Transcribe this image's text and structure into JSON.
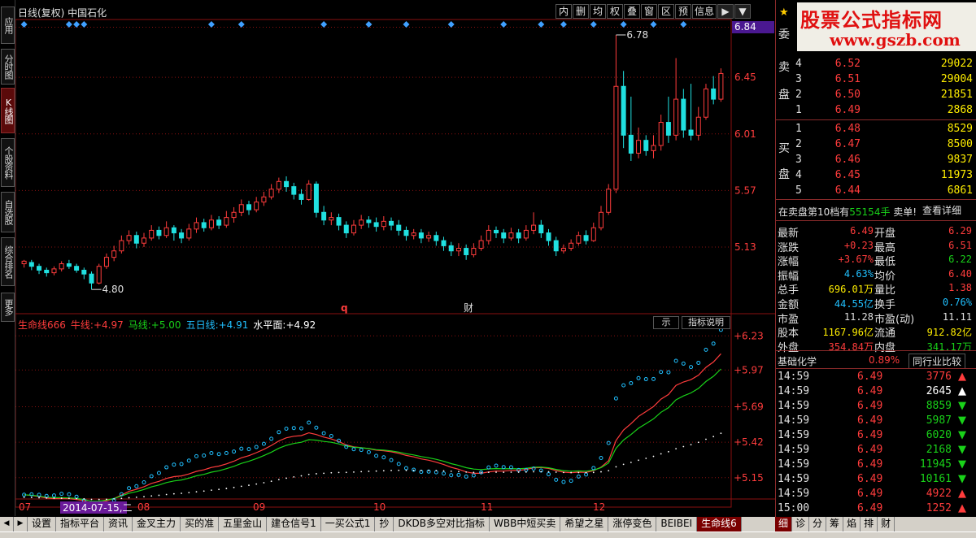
{
  "left_nav": [
    {
      "label": "应用",
      "active": false
    },
    {
      "label": "分时图",
      "active": false
    },
    {
      "label": "K线图",
      "active": true
    },
    {
      "label": "个股资料",
      "active": false
    },
    {
      "label": "自选股",
      "active": false
    },
    {
      "label": "综合排名",
      "active": false
    },
    {
      "label": "更多",
      "active": false
    }
  ],
  "chart": {
    "title": "日线(复权)  中国石化",
    "toolbar": [
      "内",
      "删",
      "均",
      "权",
      "叠",
      "窗",
      "区",
      "预",
      "信息",
      "▶",
      "▼"
    ],
    "price_axis_labels": [
      "6.84",
      "6.45",
      "6.01",
      "5.57",
      "5.13"
    ],
    "price_tag": "6.84",
    "high_marker": "6.78",
    "low_marker": "4.80",
    "event_q": "q",
    "event_cai": "财",
    "month_labels": [
      "07",
      "08",
      "09",
      "10",
      "11",
      "12"
    ],
    "date_tag": "2014-07-15,二"
  },
  "chart_data": [
    {
      "type": "candlestick",
      "title": "日线(复权) 中国石化",
      "ylim": [
        4.7,
        6.9
      ],
      "y_ticks": [
        5.13,
        5.57,
        6.01,
        6.45,
        6.84
      ],
      "x_labels": [
        "07",
        "08",
        "09",
        "10",
        "11",
        "12"
      ],
      "candles": [
        [
          5.0,
          5.02,
          4.97,
          5.03
        ],
        [
          5.01,
          4.98,
          4.95,
          5.03
        ],
        [
          4.98,
          4.95,
          4.92,
          5.0
        ],
        [
          4.95,
          4.93,
          4.9,
          4.97
        ],
        [
          4.93,
          4.96,
          4.91,
          4.98
        ],
        [
          4.96,
          5.0,
          4.94,
          5.02
        ],
        [
          5.0,
          4.98,
          4.96,
          5.03
        ],
        [
          4.98,
          4.95,
          4.93,
          5.0
        ],
        [
          4.95,
          4.92,
          4.88,
          4.97
        ],
        [
          4.92,
          4.85,
          4.8,
          4.94
        ],
        [
          4.85,
          4.98,
          4.84,
          5.0
        ],
        [
          4.98,
          5.05,
          4.96,
          5.08
        ],
        [
          5.05,
          5.1,
          5.02,
          5.14
        ],
        [
          5.1,
          5.18,
          5.08,
          5.22
        ],
        [
          5.18,
          5.22,
          5.15,
          5.26
        ],
        [
          5.22,
          5.16,
          5.12,
          5.25
        ],
        [
          5.16,
          5.2,
          5.13,
          5.24
        ],
        [
          5.2,
          5.26,
          5.18,
          5.3
        ],
        [
          5.26,
          5.22,
          5.19,
          5.29
        ],
        [
          5.22,
          5.28,
          5.2,
          5.33
        ],
        [
          5.28,
          5.24,
          5.18,
          5.3
        ],
        [
          5.24,
          5.2,
          5.16,
          5.27
        ],
        [
          5.2,
          5.27,
          5.18,
          5.31
        ],
        [
          5.27,
          5.32,
          5.24,
          5.36
        ],
        [
          5.32,
          5.28,
          5.25,
          5.35
        ],
        [
          5.28,
          5.34,
          5.26,
          5.38
        ],
        [
          5.34,
          5.3,
          5.27,
          5.37
        ],
        [
          5.3,
          5.36,
          5.28,
          5.41
        ],
        [
          5.36,
          5.4,
          5.32,
          5.44
        ],
        [
          5.4,
          5.46,
          5.37,
          5.5
        ],
        [
          5.46,
          5.42,
          5.38,
          5.49
        ],
        [
          5.42,
          5.48,
          5.4,
          5.52
        ],
        [
          5.48,
          5.52,
          5.45,
          5.56
        ],
        [
          5.52,
          5.58,
          5.5,
          5.62
        ],
        [
          5.58,
          5.64,
          5.55,
          5.67
        ],
        [
          5.64,
          5.6,
          5.56,
          5.68
        ],
        [
          5.6,
          5.54,
          5.5,
          5.63
        ],
        [
          5.54,
          5.5,
          5.46,
          5.58
        ],
        [
          5.5,
          5.62,
          5.49,
          5.65
        ],
        [
          5.62,
          5.4,
          5.36,
          5.64
        ],
        [
          5.4,
          5.34,
          5.3,
          5.45
        ],
        [
          5.34,
          5.36,
          5.3,
          5.4
        ],
        [
          5.36,
          5.3,
          5.26,
          5.39
        ],
        [
          5.3,
          5.24,
          5.2,
          5.33
        ],
        [
          5.24,
          5.3,
          5.22,
          5.34
        ],
        [
          5.3,
          5.34,
          5.27,
          5.38
        ],
        [
          5.34,
          5.32,
          5.28,
          5.37
        ],
        [
          5.32,
          5.29,
          5.25,
          5.36
        ],
        [
          5.29,
          5.33,
          5.26,
          5.37
        ],
        [
          5.33,
          5.3,
          5.26,
          5.36
        ],
        [
          5.3,
          5.26,
          5.22,
          5.34
        ],
        [
          5.26,
          5.22,
          5.18,
          5.29
        ],
        [
          5.22,
          5.24,
          5.19,
          5.27
        ],
        [
          5.24,
          5.2,
          5.16,
          5.27
        ],
        [
          5.2,
          5.22,
          5.17,
          5.25
        ],
        [
          5.22,
          5.18,
          5.14,
          5.25
        ],
        [
          5.18,
          5.14,
          5.1,
          5.21
        ],
        [
          5.14,
          5.1,
          5.06,
          5.17
        ],
        [
          5.1,
          5.12,
          5.06,
          5.16
        ],
        [
          5.12,
          5.07,
          5.03,
          5.15
        ],
        [
          5.07,
          5.12,
          5.05,
          5.16
        ],
        [
          5.12,
          5.18,
          5.1,
          5.22
        ],
        [
          5.18,
          5.26,
          5.15,
          5.3
        ],
        [
          5.26,
          5.24,
          5.2,
          5.29
        ],
        [
          5.24,
          5.2,
          5.16,
          5.27
        ],
        [
          5.2,
          5.24,
          5.18,
          5.28
        ],
        [
          5.24,
          5.2,
          5.16,
          5.27
        ],
        [
          5.2,
          5.26,
          5.18,
          5.3
        ],
        [
          5.26,
          5.3,
          5.23,
          5.4
        ],
        [
          5.3,
          5.24,
          5.2,
          5.34
        ],
        [
          5.24,
          5.18,
          5.14,
          5.27
        ],
        [
          5.18,
          5.1,
          5.06,
          5.21
        ],
        [
          5.1,
          5.12,
          5.08,
          5.15
        ],
        [
          5.12,
          5.16,
          5.1,
          5.19
        ],
        [
          5.16,
          5.22,
          5.14,
          5.25
        ],
        [
          5.22,
          5.18,
          5.15,
          5.26
        ],
        [
          5.18,
          5.28,
          5.17,
          5.32
        ],
        [
          5.28,
          5.4,
          5.26,
          5.45
        ],
        [
          5.4,
          5.58,
          5.38,
          5.62
        ],
        [
          5.58,
          6.38,
          5.55,
          6.78
        ],
        [
          6.38,
          6.0,
          5.9,
          6.5
        ],
        [
          6.0,
          5.86,
          5.8,
          6.3
        ],
        [
          5.86,
          5.96,
          5.82,
          6.06
        ],
        [
          5.96,
          5.88,
          5.84,
          6.0
        ],
        [
          5.88,
          5.92,
          5.82,
          6.0
        ],
        [
          5.92,
          6.1,
          5.88,
          6.16
        ],
        [
          6.1,
          6.0,
          5.94,
          6.3
        ],
        [
          6.0,
          6.28,
          5.96,
          6.6
        ],
        [
          6.28,
          6.04,
          5.98,
          6.36
        ],
        [
          6.04,
          6.0,
          5.96,
          6.4
        ],
        [
          6.0,
          6.14,
          5.96,
          6.22
        ],
        [
          6.14,
          6.36,
          6.12,
          6.4
        ],
        [
          6.36,
          6.28,
          6.24,
          6.46
        ],
        [
          6.28,
          6.48,
          6.26,
          6.52
        ]
      ]
    },
    {
      "type": "line",
      "title": "生命线666",
      "ylim": [
        5.0,
        6.3
      ],
      "y_ticks": [
        5.15,
        5.42,
        5.69,
        5.97,
        6.23
      ],
      "series": [
        {
          "name": "牛线",
          "color": "#ff3c3c",
          "last": "+4.97"
        },
        {
          "name": "马线",
          "color": "#19d219",
          "last": "+5.00"
        },
        {
          "name": "五日线",
          "color": "#20c0ff",
          "last": "+4.91"
        },
        {
          "name": "水平面",
          "color": "#ffffff",
          "last": "+4.92"
        }
      ]
    }
  ],
  "indicator": {
    "name": "生命线666",
    "lines": [
      {
        "label": "牛线:",
        "value": "+4.97",
        "color": "#ff3c3c"
      },
      {
        "label": "马线:",
        "value": "+5.00",
        "color": "#19d219"
      },
      {
        "label": "五日线:",
        "value": "+4.91",
        "color": "#20c0ff"
      },
      {
        "label": "水平面:",
        "value": "+4.92",
        "color": "#ffffff"
      }
    ],
    "axis_labels": [
      "+6.23",
      "+5.97",
      "+5.69",
      "+5.42",
      "+5.15"
    ],
    "btn_small": "示",
    "btn_explain": "指标说明"
  },
  "bottom_tabs": [
    "设置",
    "指标平台",
    "资讯",
    "金叉主力",
    "买的准",
    "五里金山",
    "建仓信号1",
    "一买公式1",
    "抄",
    "DKDB多空对比指标",
    "WBB中短买卖",
    "希望之星",
    "涨停变色",
    "BEIBEI",
    "生命线6"
  ],
  "active_tab": "生命线6",
  "right_tabs": [
    "细",
    "诊",
    "分",
    "筹",
    "焰",
    "排",
    "财"
  ],
  "right_active_tab": "细",
  "logo": {
    "title": "股票公式指标网",
    "url": "www.gszb.com"
  },
  "orderbook": {
    "sell_label_1": "卖",
    "sell_label_2": "盘",
    "buy_label_1": "买",
    "buy_label_2": "盘",
    "partial_label": "委",
    "sell_rows": [
      {
        "level": "4",
        "price": "6.52",
        "volume": "29022"
      },
      {
        "level": "3",
        "price": "6.51",
        "volume": "29004"
      },
      {
        "level": "2",
        "price": "6.50",
        "volume": "21851"
      },
      {
        "level": "1",
        "price": "6.49",
        "volume": "2868"
      }
    ],
    "buy_rows": [
      {
        "level": "1",
        "price": "6.48",
        "volume": "8529"
      },
      {
        "level": "2",
        "price": "6.47",
        "volume": "8500"
      },
      {
        "level": "3",
        "price": "6.46",
        "volume": "9837"
      },
      {
        "level": "4",
        "price": "6.45",
        "volume": "11973"
      },
      {
        "level": "5",
        "price": "6.44",
        "volume": "6861"
      }
    ]
  },
  "note": {
    "prefix": "在卖盘第10档有",
    "amount": "55154手",
    "suffix": "卖单!",
    "button": "查看详细"
  },
  "stats_left": [
    {
      "key": "最新",
      "value": "6.49",
      "color": "#ff3c3c"
    },
    {
      "key": "涨跌",
      "value": "+0.23",
      "color": "#ff3c3c"
    },
    {
      "key": "涨幅",
      "value": "+3.67%",
      "color": "#ff3c3c"
    },
    {
      "key": "振幅",
      "value": "4.63%",
      "color": "#20c0ff"
    },
    {
      "key": "总手",
      "value": "696.01万",
      "color": "#ffee00"
    },
    {
      "key": "金额",
      "value": "44.55亿",
      "color": "#20c0ff"
    },
    {
      "key": "市盈",
      "value": "11.28",
      "color": "#e0e0e0"
    },
    {
      "key": "股本",
      "value": "1167.96亿",
      "color": "#ffee00"
    },
    {
      "key": "外盘",
      "value": "354.84万",
      "color": "#ff3c3c"
    }
  ],
  "stats_right": [
    {
      "key": "开盘",
      "value": "6.29",
      "color": "#ff3c3c"
    },
    {
      "key": "最高",
      "value": "6.51",
      "color": "#ff3c3c"
    },
    {
      "key": "最低",
      "value": "6.22",
      "color": "#19d219"
    },
    {
      "key": "均价",
      "value": "6.40",
      "color": "#ff3c3c"
    },
    {
      "key": "量比",
      "value": "1.38",
      "color": "#ff3c3c"
    },
    {
      "key": "换手",
      "value": "0.76%",
      "color": "#20c0ff"
    },
    {
      "key": "市盈(动)",
      "value": "11.11",
      "color": "#e0e0e0"
    },
    {
      "key": "流通",
      "value": "912.82亿",
      "color": "#ffee00"
    },
    {
      "key": "内盘",
      "value": "341.17万",
      "color": "#19d219"
    }
  ],
  "industry": {
    "name": "基础化学",
    "pct": "0.89%",
    "compare": "同行业比较"
  },
  "ticks": [
    {
      "time": "14:59",
      "price": "6.49",
      "volume": "3776",
      "dir": "up",
      "vcolor": "#ff3c3c"
    },
    {
      "time": "14:59",
      "price": "6.49",
      "volume": "2645",
      "dir": "up",
      "vcolor": "#ffffff"
    },
    {
      "time": "14:59",
      "price": "6.49",
      "volume": "8859",
      "dir": "down",
      "vcolor": "#19d219"
    },
    {
      "time": "14:59",
      "price": "6.49",
      "volume": "5987",
      "dir": "down",
      "vcolor": "#19d219"
    },
    {
      "time": "14:59",
      "price": "6.49",
      "volume": "6020",
      "dir": "down",
      "vcolor": "#19d219"
    },
    {
      "time": "14:59",
      "price": "6.49",
      "volume": "2168",
      "dir": "down",
      "vcolor": "#19d219"
    },
    {
      "time": "14:59",
      "price": "6.49",
      "volume": "11945",
      "dir": "down",
      "vcolor": "#19d219"
    },
    {
      "time": "14:59",
      "price": "6.49",
      "volume": "10161",
      "dir": "down",
      "vcolor": "#19d219"
    },
    {
      "time": "14:59",
      "price": "6.49",
      "volume": "4922",
      "dir": "up",
      "vcolor": "#ff3c3c"
    },
    {
      "time": "15:00",
      "price": "6.49",
      "volume": "1252",
      "dir": "up",
      "vcolor": "#ff3c3c"
    }
  ],
  "colors": {
    "up": "#ff3c3c",
    "down": "#20e0e0",
    "grid": "#8a1010",
    "diamond": "#40a0ff",
    "accent": "#4a1890"
  }
}
